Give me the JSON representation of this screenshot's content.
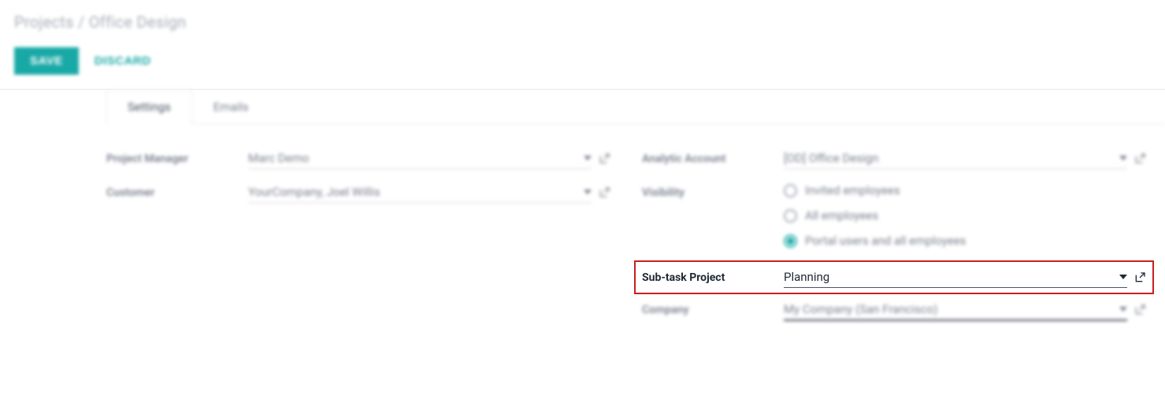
{
  "breadcrumb": {
    "root": "Projects",
    "separator": "/",
    "current": "Office Design"
  },
  "actions": {
    "save": "SAVE",
    "discard": "DISCARD"
  },
  "tabs": [
    {
      "label": "Settings",
      "active": true
    },
    {
      "label": "Emails",
      "active": false
    }
  ],
  "left": {
    "project_manager": {
      "label": "Project Manager",
      "value": "Marc Demo"
    },
    "customer": {
      "label": "Customer",
      "value": "YourCompany, Joel Willis"
    }
  },
  "right": {
    "analytic_account": {
      "label": "Analytic Account",
      "value": "[OD] Office Design"
    },
    "visibility": {
      "label": "Visibility",
      "options": [
        {
          "label": "Invited employees",
          "selected": false
        },
        {
          "label": "All employees",
          "selected": false
        },
        {
          "label": "Portal users and all employees",
          "selected": true
        }
      ]
    },
    "sub_task_project": {
      "label": "Sub-task Project",
      "value": "Planning"
    },
    "company": {
      "label": "Company",
      "value": "My Company (San Francisco)"
    }
  }
}
